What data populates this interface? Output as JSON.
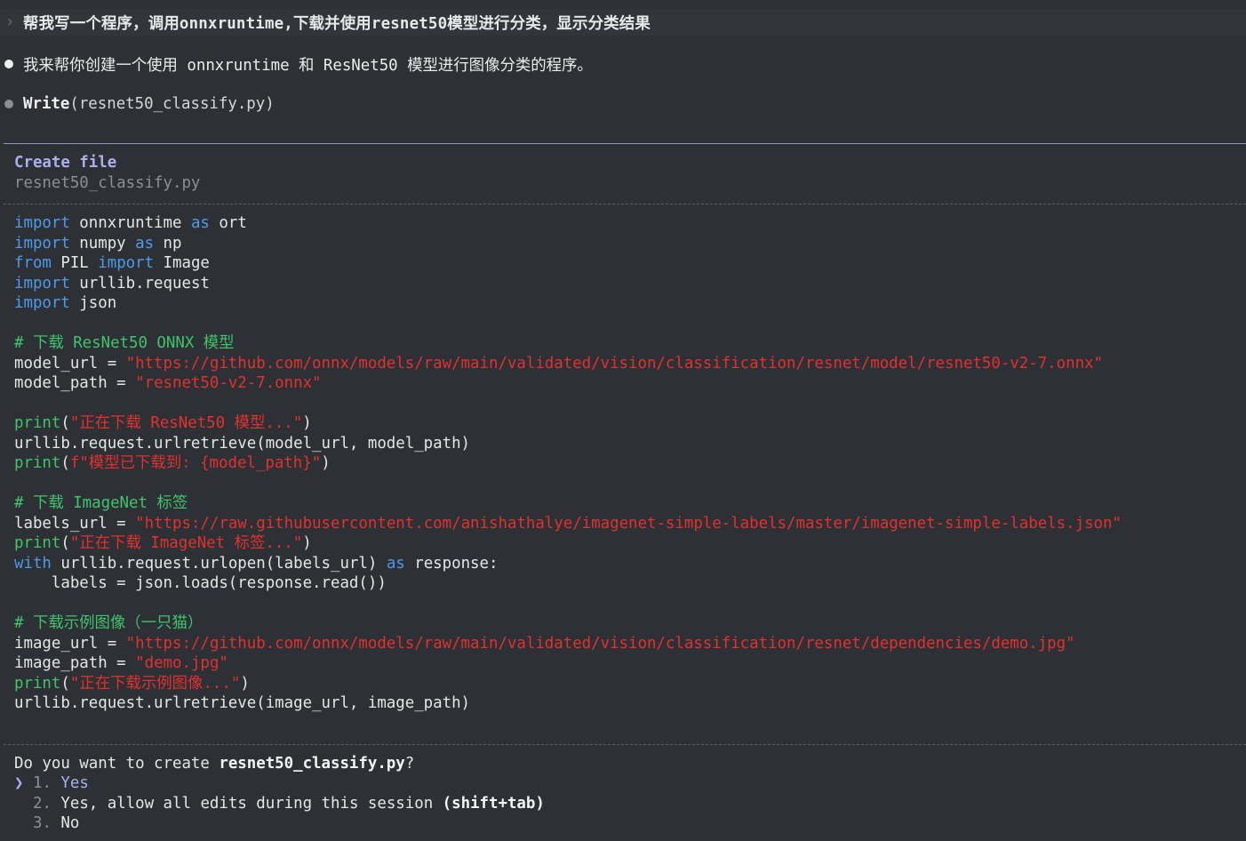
{
  "prompt": {
    "chevron": "›",
    "text": "帮我写一个程序，调用onnxruntime,下载并使用resnet50模型进行分类，显示分类结果"
  },
  "assistant": {
    "message": "我来帮你创建一个使用 onnxruntime 和 ResNet50 模型进行图像分类的程序。",
    "tool_name": "Write",
    "tool_arg": "(resnet50_classify.py)"
  },
  "create_panel": {
    "title": "Create file",
    "filename": "resnet50_classify.py"
  },
  "code": {
    "l1_kw1": "import",
    "l1_t1": " onnxruntime ",
    "l1_kw2": "as",
    "l1_t2": " ort",
    "l2_kw1": "import",
    "l2_t1": " numpy ",
    "l2_kw2": "as",
    "l2_t2": " np",
    "l3_kw1": "from",
    "l3_t1": " PIL ",
    "l3_kw2": "import",
    "l3_t2": " Image",
    "l4_kw1": "import",
    "l4_t1": " urllib.request",
    "l5_kw1": "import",
    "l5_t1": " json",
    "c1": "# 下载 ResNet50 ONNX 模型",
    "l7_t1": "model_url = ",
    "l7_s1": "\"https://github.com/onnx/models/raw/main/validated/vision/classification/resnet/model/resnet50-v2-7.onnx\"",
    "l8_t1": "model_path = ",
    "l8_s1": "\"resnet50-v2-7.onnx\"",
    "l10_f": "print",
    "l10_p1": "(",
    "l10_s1": "\"正在下载 ResNet50 模型...\"",
    "l10_p2": ")",
    "l11_t1": "urllib.request.urlretrieve(model_url, model_path)",
    "l12_f": "print",
    "l12_p1": "(",
    "l12_s1": "f\"模型已下载到: {model_path}\"",
    "l12_p2": ")",
    "c2": "# 下载 ImageNet 标签",
    "l15_t1": "labels_url = ",
    "l15_s1": "\"https://raw.githubusercontent.com/anishathalye/imagenet-simple-labels/master/imagenet-simple-labels.json\"",
    "l16_f": "print",
    "l16_p1": "(",
    "l16_s1": "\"正在下载 ImageNet 标签...\"",
    "l16_p2": ")",
    "l17_kw1": "with",
    "l17_t1": " urllib.request.urlopen(labels_url) ",
    "l17_kw2": "as",
    "l17_t2": " response:",
    "l18_t1": "    labels = json.loads(response.read())",
    "c3": "# 下载示例图像（一只猫）",
    "l21_t1": "image_url = ",
    "l21_s1": "\"https://github.com/onnx/models/raw/main/validated/vision/classification/resnet/dependencies/demo.jpg\"",
    "l22_t1": "image_path = ",
    "l22_s1": "\"demo.jpg\"",
    "l23_f": "print",
    "l23_p1": "(",
    "l23_s1": "\"正在下载示例图像...\"",
    "l23_p2": ")",
    "l24_t1": "urllib.request.urlretrieve(image_url, image_path)"
  },
  "confirm": {
    "question_prefix": "Do you want to create ",
    "question_file": "resnet50_classify.py",
    "question_suffix": "?",
    "selector": "❯",
    "options": [
      {
        "num": "1.",
        "label": "Yes"
      },
      {
        "num": "2.",
        "label": "Yes, allow all edits during this session ",
        "hint": "(shift+tab)"
      },
      {
        "num": "3.",
        "label": "No"
      }
    ]
  },
  "colors": {
    "background": "#2d3035",
    "keyword": "#4f9ae6",
    "string": "#e2312f",
    "comment": "#3fc46c",
    "accent": "#a9b0ee"
  }
}
